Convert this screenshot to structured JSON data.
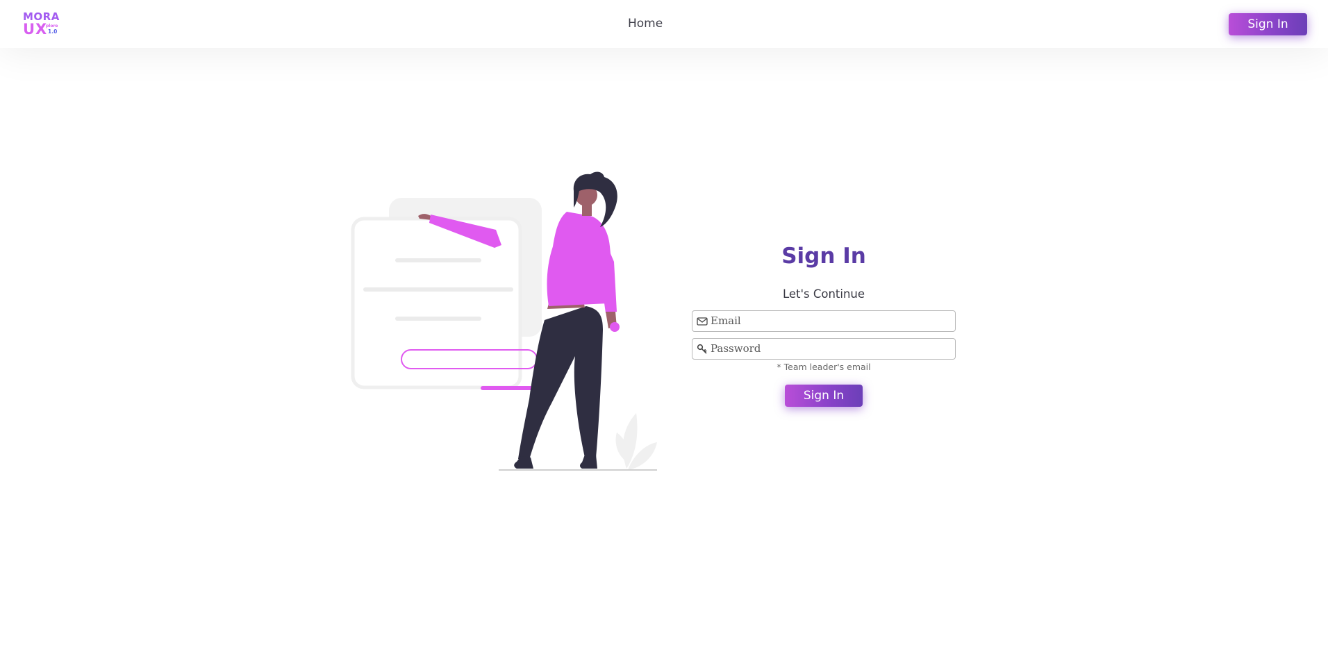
{
  "logo": {
    "line1": "MORA",
    "line2": "UX",
    "suffix": "plore",
    "version": "1.0"
  },
  "nav": {
    "home_label": "Home",
    "signin_label": "Sign In"
  },
  "form": {
    "title": "Sign In",
    "subtitle": "Let's Continue",
    "email_placeholder": "Email",
    "password_placeholder": "Password",
    "hint": "* Team leader's email",
    "submit_label": "Sign In"
  },
  "icons": {
    "email": "envelope-icon",
    "password": "key-icon"
  },
  "colors": {
    "accent_purple": "#5a3ba5",
    "button_gradient_start": "#b94ed8",
    "button_gradient_end": "#6c3fb8",
    "illustration_magenta": "#e05af0",
    "illustration_dark": "#2f2e41"
  }
}
